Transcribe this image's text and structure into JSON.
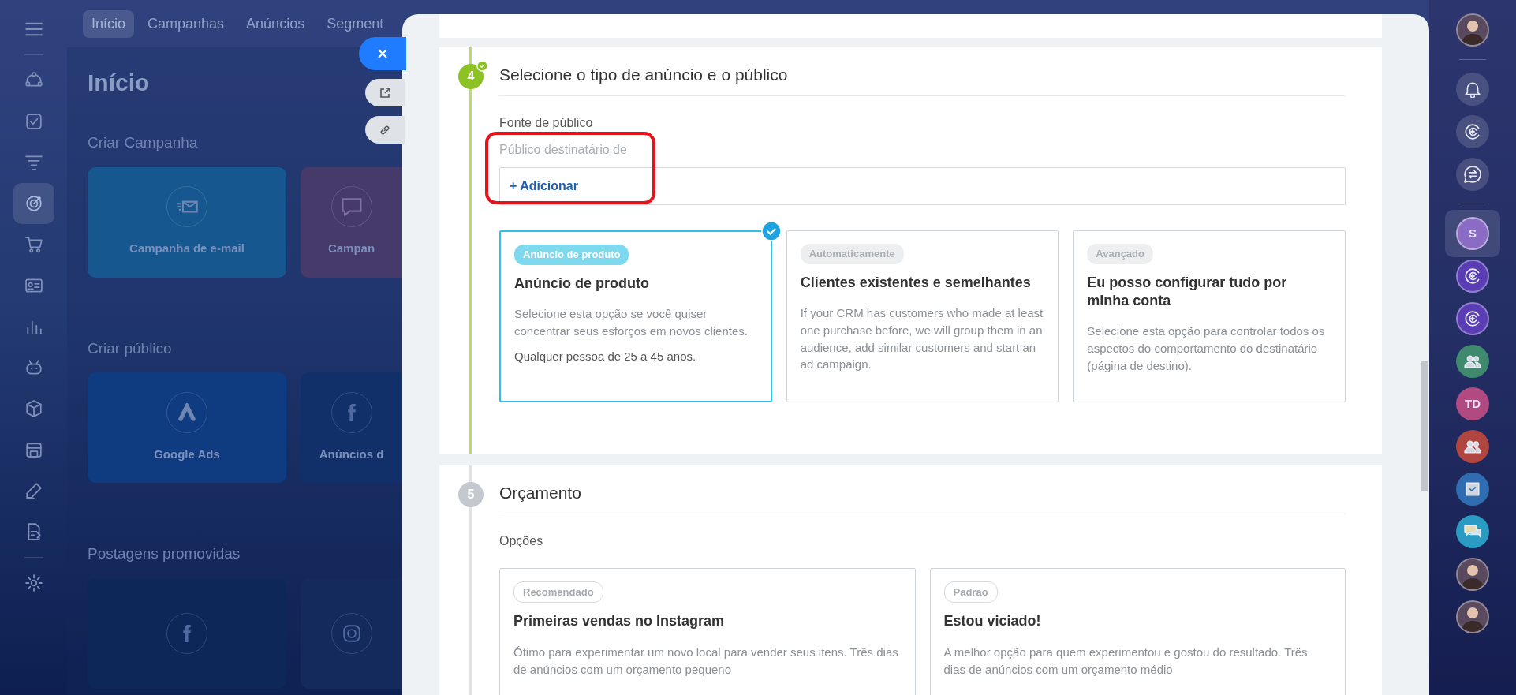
{
  "top_nav": {
    "tabs": [
      {
        "label": "Início",
        "selected": true
      },
      {
        "label": "Campanhas",
        "selected": false
      },
      {
        "label": "Anúncios",
        "selected": false
      },
      {
        "label": "Segment",
        "selected": false
      }
    ]
  },
  "left_sidebar": {
    "items": [
      {
        "kind": "flow",
        "selected": false
      },
      {
        "kind": "task",
        "selected": false
      },
      {
        "kind": "funnel",
        "selected": false
      },
      {
        "kind": "target",
        "selected": true
      },
      {
        "kind": "cart",
        "selected": false
      },
      {
        "kind": "contact",
        "selected": false
      },
      {
        "kind": "chart",
        "selected": false
      },
      {
        "kind": "robot",
        "selected": false
      },
      {
        "kind": "box",
        "selected": false
      },
      {
        "kind": "store",
        "selected": false
      },
      {
        "kind": "pen",
        "selected": false
      },
      {
        "kind": "doc",
        "selected": false
      },
      {
        "kind": "gear",
        "selected": false
      }
    ]
  },
  "page": {
    "title": "Início",
    "sections": [
      {
        "title": "Criar Campanha",
        "tiles": [
          {
            "kind": "email",
            "label": "Campanha de e-mail",
            "color": "#16578f"
          },
          {
            "kind": "sms",
            "label": "Campan",
            "color": "#453a6a"
          }
        ]
      },
      {
        "title": "Criar público",
        "tiles": [
          {
            "kind": "google",
            "label": "Google Ads",
            "color": "#0f3c80"
          },
          {
            "kind": "facebook",
            "label": "Anúncios d",
            "color": "#11306a"
          }
        ]
      },
      {
        "title": "Postagens promovidas",
        "tiles": [
          {
            "kind": "facebook",
            "color": "#0d2858"
          },
          {
            "kind": "instagram",
            "color": "#142a5c"
          }
        ]
      }
    ]
  },
  "steps": [
    {
      "kind": "audience",
      "number": "4",
      "done": true,
      "title": "Selecione o tipo de anúncio e o público",
      "section_label": "Fonte de público",
      "audience": {
        "label": "Público destinatário de",
        "add_link": "+ Adicionar",
        "highlighted": true
      },
      "options": [
        {
          "tag": "Anúncio de produto",
          "title": "Anúncio de produto",
          "description": "Selecione esta opção se você quiser concentrar seus esforços em novos clientes.",
          "note": "Qualquer pessoa de 25 a 45 anos.",
          "selected": true
        },
        {
          "tag": "Automaticamente",
          "title": "Clientes existentes e semelhantes",
          "description": "If your CRM has customers who made at least one purchase before, we will group them in an audience, add similar customers and start an ad campaign.",
          "selected": false
        },
        {
          "tag": "Avançado",
          "title": "Eu posso configurar tudo por minha conta",
          "description": "Selecione esta opção para controlar todos os aspectos do comportamento do destinatário (página de destino).",
          "selected": false
        }
      ]
    },
    {
      "kind": "budget",
      "number": "5",
      "done": false,
      "title": "Orçamento",
      "section_label": "Opções",
      "options": [
        {
          "tag": "Recomendado",
          "title": "Primeiras vendas no Instagram",
          "description": "Ótimo para experimentar um novo local para vender seus itens. Três dias de anúncios com um orçamento pequeno",
          "selected": false
        },
        {
          "tag": "Padrão",
          "title": "Estou viciado!",
          "description": "A melhor opção para quem experimentou e gostou do resultado. Três dias de anúncios com um orçamento médio",
          "selected": false
        }
      ]
    }
  ],
  "right_sidebar": {
    "items": [
      {
        "kind": "avatar",
        "selected": false
      },
      {
        "kind": "bell",
        "selected": false
      },
      {
        "kind": "copilot",
        "selected": false
      },
      {
        "kind": "swap",
        "selected": false
      },
      {
        "kind": "letter",
        "text": "S",
        "color": "#8a6cc4",
        "selected": true
      },
      {
        "kind": "ring",
        "color": "#5a3db5",
        "selected": false
      },
      {
        "kind": "ring",
        "color": "#5a3db5",
        "selected": false
      },
      {
        "kind": "group",
        "color": "#3f8a6e",
        "selected": false
      },
      {
        "kind": "letter",
        "text": "TD",
        "color": "#b04a80",
        "selected": false
      },
      {
        "kind": "group",
        "color": "#b0463f",
        "selected": false
      },
      {
        "kind": "task",
        "color": "#2f6cb0",
        "selected": false
      },
      {
        "kind": "chat",
        "color": "#2a9cc4",
        "selected": false
      },
      {
        "kind": "avatar",
        "selected": false
      },
      {
        "kind": "avatar",
        "selected": false
      }
    ]
  }
}
